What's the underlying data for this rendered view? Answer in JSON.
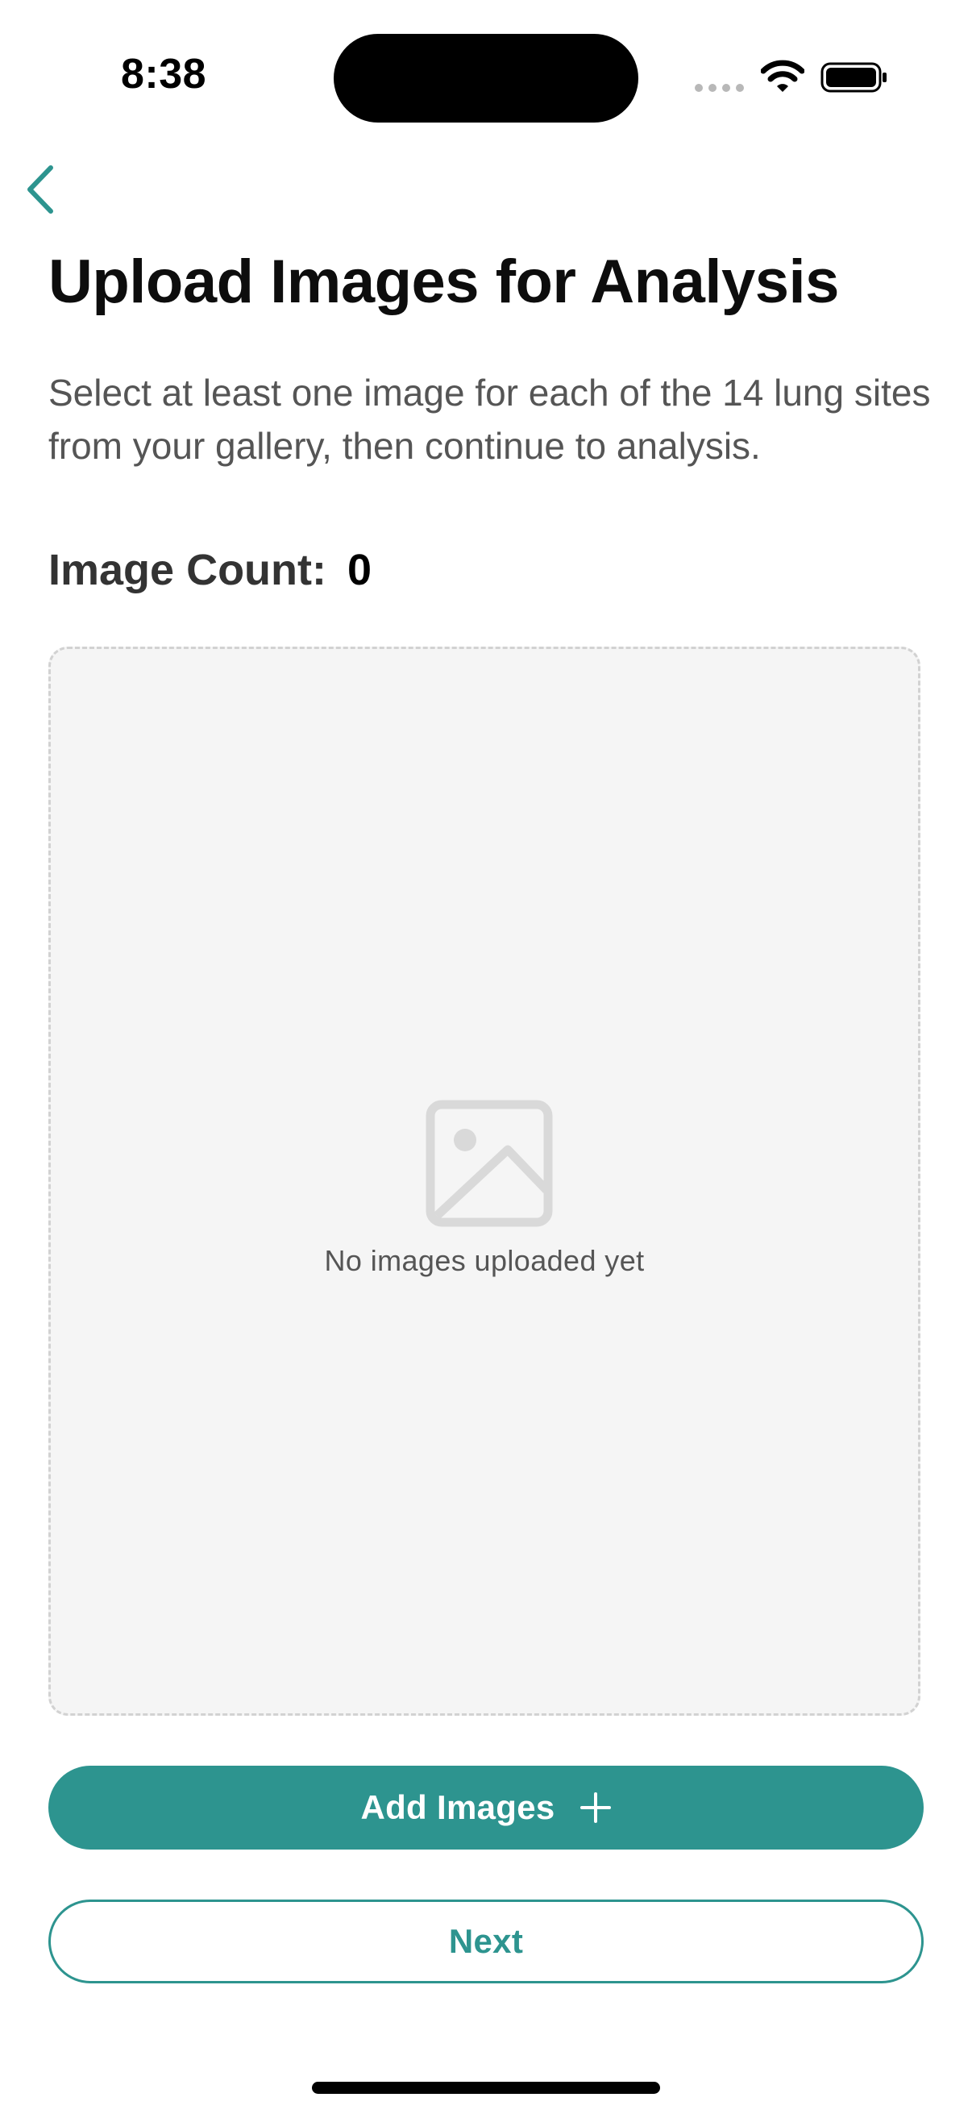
{
  "status_bar": {
    "time": "8:38"
  },
  "header": {
    "back_icon": "chevron-left-icon",
    "title": "Upload Images for Analysis",
    "description": "Select at least one image for each of the 14 lung sites from your gallery, then continue to analysis."
  },
  "image_count": {
    "label": "Image Count:",
    "value": "0"
  },
  "dropzone": {
    "icon": "image-placeholder-icon",
    "empty_text": "No images uploaded yet"
  },
  "actions": {
    "add_label": "Add Images",
    "add_icon": "plus-icon",
    "next_label": "Next"
  },
  "colors": {
    "accent": "#2d948f",
    "dropzone_background": "#f5f5f5",
    "dropzone_border": "#d2d2d2"
  }
}
